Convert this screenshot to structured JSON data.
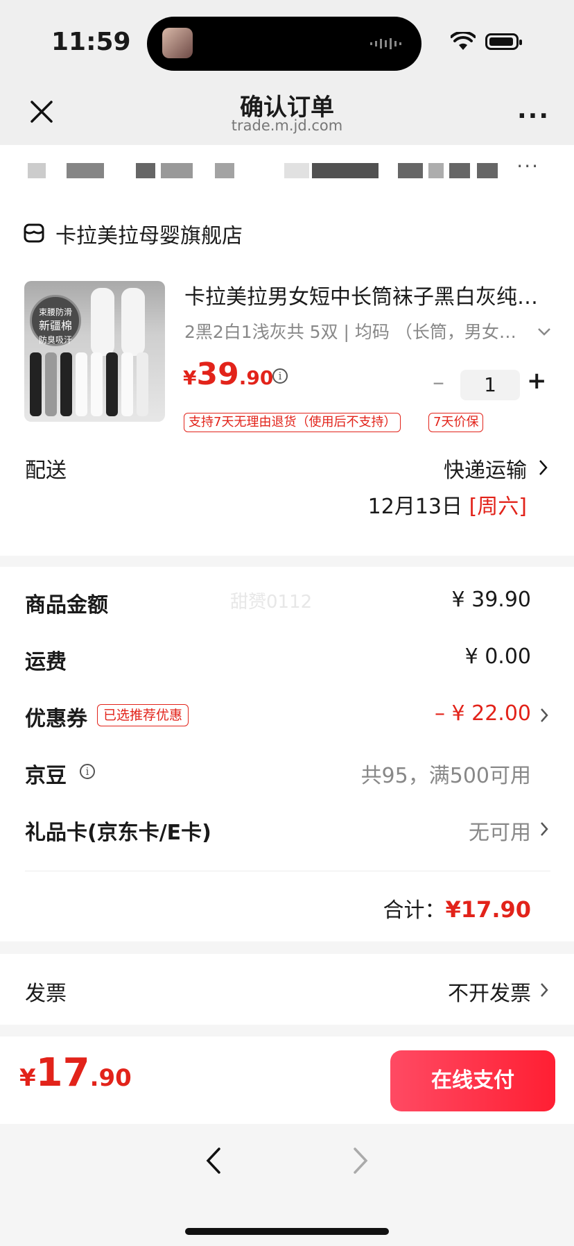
{
  "status_bar": {
    "time": "11:59"
  },
  "nav": {
    "title": "确认订单",
    "url": "trade.m.jd.com",
    "more_icon": "more-icon",
    "close_icon": "close-icon"
  },
  "address": {
    "more": "···"
  },
  "store": {
    "name": "卡拉美拉母婴旗舰店",
    "icon": "store-icon"
  },
  "product": {
    "thumb_badge_line1": "束腰防滑",
    "thumb_badge_line2": "新疆棉",
    "thumb_badge_line3": "防臭吸汗",
    "title": "卡拉美拉男女短中长筒袜子黑白灰纯…",
    "spec": "2黑2白1浅灰共 5双 | 均码 （长筒，男女…",
    "price_symbol": "¥",
    "price_int": "39",
    "price_dec": ".90",
    "quantity": "1",
    "tags": [
      "支持7天无理由退货（使用后不支持）",
      "7天价保"
    ]
  },
  "shipping": {
    "label": "配送",
    "method": "快递运输",
    "date": "12月13日",
    "weekday": "[周六]"
  },
  "summary": {
    "watermark": "甜赟0112",
    "items": [
      {
        "label": "商品金额",
        "value": "¥ 39.90"
      },
      {
        "label": "运费",
        "value": "¥ 0.00"
      },
      {
        "label": "优惠券",
        "tag": "已选推荐优惠",
        "value": "– ¥ 22.00"
      },
      {
        "label": "京豆",
        "value": "共95，满500可用"
      },
      {
        "label": "礼品卡(京东卡/E卡)",
        "value": "无可用"
      }
    ],
    "total_label": "合计：",
    "total_value": "¥17.90"
  },
  "invoice": {
    "label": "发票",
    "value": "不开发票"
  },
  "pay": {
    "price_symbol": "¥",
    "price_int": "17",
    "price_dec": ".90",
    "button": "在线支付"
  },
  "colors": {
    "accent": "#e2231a",
    "pay_button": "#ff2a40"
  }
}
